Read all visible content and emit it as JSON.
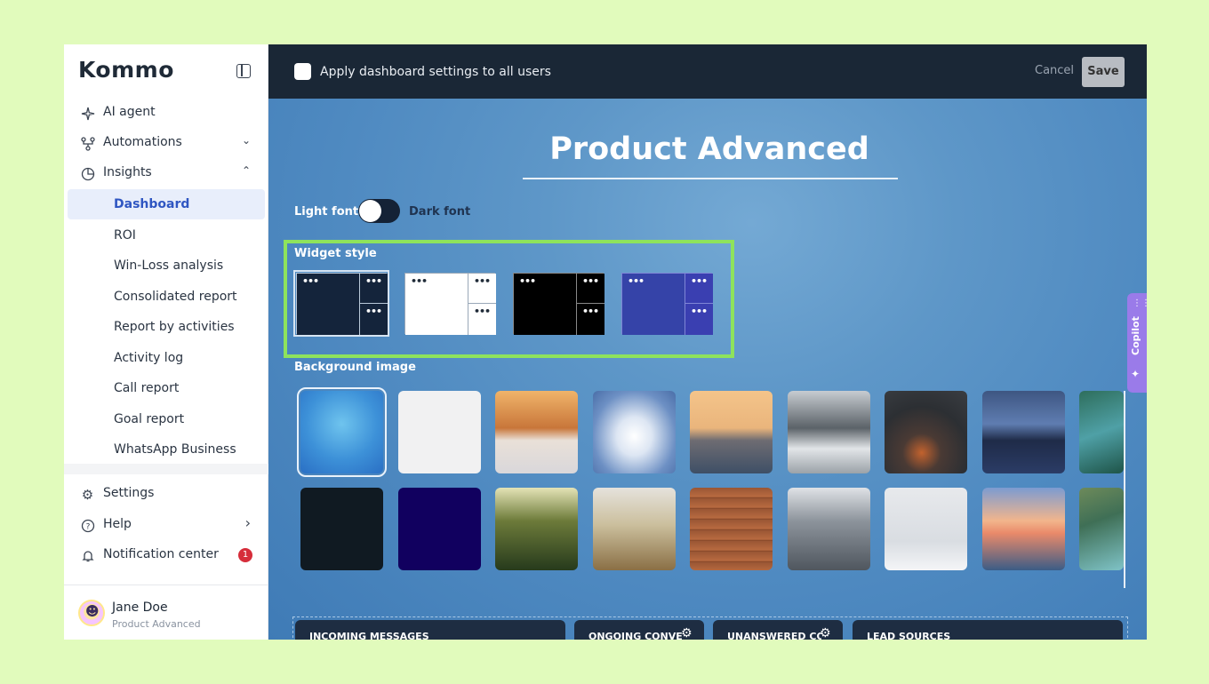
{
  "brand": {
    "logo_text": "Kommo"
  },
  "sidebar": {
    "items": [
      {
        "label": "AI agent",
        "icon": "sparkle-icon"
      },
      {
        "label": "Automations",
        "icon": "flow-icon",
        "chevron": "⌄"
      },
      {
        "label": "Insights",
        "icon": "pie-chart-icon",
        "chevron": "⌃"
      }
    ],
    "insights_sub": [
      "Dashboard",
      "ROI",
      "Win-Loss analysis",
      "Consolidated report",
      "Report by activities",
      "Activity log",
      "Call report",
      "Goal report",
      "WhatsApp Business"
    ],
    "active_sub": "Dashboard",
    "bottom_items": [
      {
        "label": "Settings",
        "icon": "gear-icon"
      },
      {
        "label": "Help",
        "icon": "help-icon",
        "chevron": "›"
      },
      {
        "label": "Notification center",
        "icon": "bell-icon",
        "badge": "1"
      }
    ],
    "user": {
      "name": "Jane Doe",
      "role": "Product Advanced"
    }
  },
  "topbar": {
    "apply_label": "Apply dashboard settings to all users",
    "cancel_label": "Cancel",
    "save_label": "Save"
  },
  "dashboard": {
    "title": "Product Advanced",
    "light_font_label": "Light font",
    "dark_font_label": "Dark font",
    "widget_style_label": "Widget style",
    "widget_styles": [
      {
        "name": "dark-navy",
        "main": "#14243b",
        "side": "#14243b",
        "border": "#b9c9da",
        "dots": "#ffffff",
        "selected": true
      },
      {
        "name": "white",
        "main": "#ffffff",
        "side": "#ffffff",
        "border": "#9aa8b8",
        "dots": "#1f2a37",
        "selected": false
      },
      {
        "name": "black",
        "main": "#000000",
        "side": "#000000",
        "border": "#888888",
        "dots": "#ffffff",
        "selected": false
      },
      {
        "name": "indigo",
        "main": "#3543a8",
        "side": "#3a3fb1",
        "border": "#7f86d6",
        "dots": "#ffffff",
        "selected": false
      }
    ],
    "background_label": "Background image",
    "background_rows": [
      [
        "blue-gradient",
        "light-gray",
        "golden-gate-bridge",
        "clouds-sunbeams",
        "sunset-sea",
        "misty-mountain",
        "rainy-window-night",
        "city-skyline-night",
        "coastal-road"
      ],
      [
        "dark-slate",
        "deep-indigo",
        "forest-sunlight",
        "wheat-field",
        "wood-planks",
        "aerial-city",
        "winter-tree",
        "sea-sunset",
        "tropical-cliffs"
      ]
    ],
    "selected_background": "blue-gradient",
    "copilot_label": "Copilot",
    "widgets": [
      "INCOMING MESSAGES",
      "ONGOING CONVERSATIONS",
      "UNANSWERED CONVERSATIONS",
      "LEAD SOURCES"
    ]
  },
  "colors": {
    "accent": "#2f56c2",
    "topbar": "#1a2736",
    "highlight": "#8ee35c",
    "copilot": "#9a7be9"
  }
}
